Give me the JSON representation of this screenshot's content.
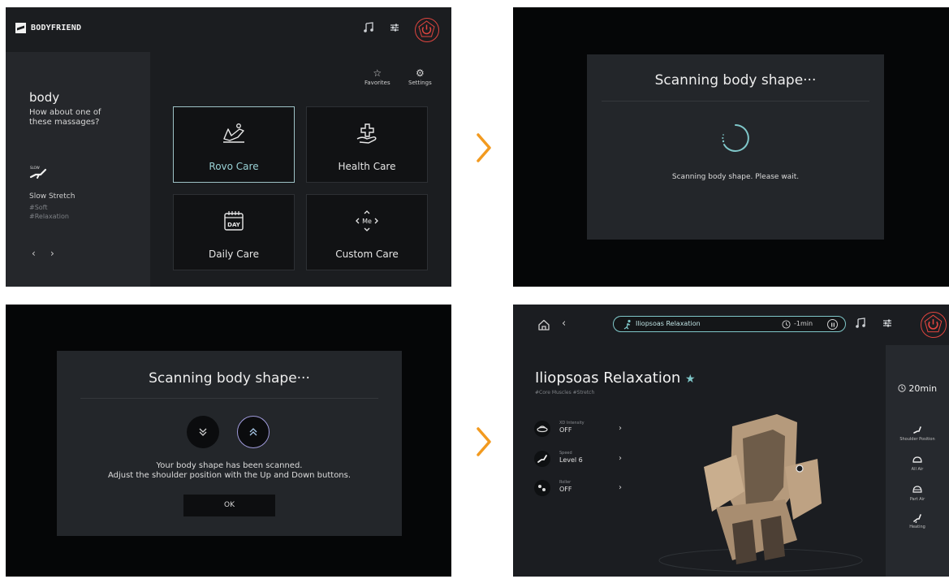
{
  "screen1": {
    "brand": "BODYFRIEND",
    "greeting_title": "body",
    "greeting_sub": "How about one of these massages?",
    "featured": {
      "icon_badge": "SLOW",
      "name": "Slow Stretch",
      "tags": [
        "#Soft",
        "#Relaxation"
      ],
      "prev": "‹",
      "next": "›"
    },
    "favorites_label": "Favorites",
    "settings_label": "Settings",
    "cards": [
      {
        "label": "Rovo Care"
      },
      {
        "label": "Health Care"
      },
      {
        "label": "Daily Care",
        "icon_text": "DAY"
      },
      {
        "label": "Custom Care",
        "icon_text": "Me"
      }
    ]
  },
  "screen2": {
    "title": "Scanning body shape···",
    "message": "Scanning body shape. Please wait."
  },
  "screen3": {
    "title": "Scanning body shape···",
    "message_line1": "Your body shape has been scanned.",
    "message_line2": "Adjust the shoulder position with the Up and Down buttons.",
    "ok_label": "OK"
  },
  "screen4": {
    "program_pill": "Iliopsoas Relaxation",
    "remaining": "-1min",
    "title": "Iliopsoas Relaxation",
    "tags": "#Core Muscles #Stretch",
    "options": [
      {
        "label": "XD Intensity",
        "value": "OFF"
      },
      {
        "label": "Speed",
        "value": "Level 6"
      },
      {
        "label": "Roller",
        "value": "OFF"
      }
    ],
    "duration": "20min",
    "side": [
      {
        "label": "Shoulder Position"
      },
      {
        "label": "All Air"
      },
      {
        "label": "Part Air"
      },
      {
        "label": "Heating"
      }
    ]
  },
  "colors": {
    "accent": "#7fc7c9",
    "power": "#e0453f",
    "flow_arrow": "#f29a1f"
  }
}
